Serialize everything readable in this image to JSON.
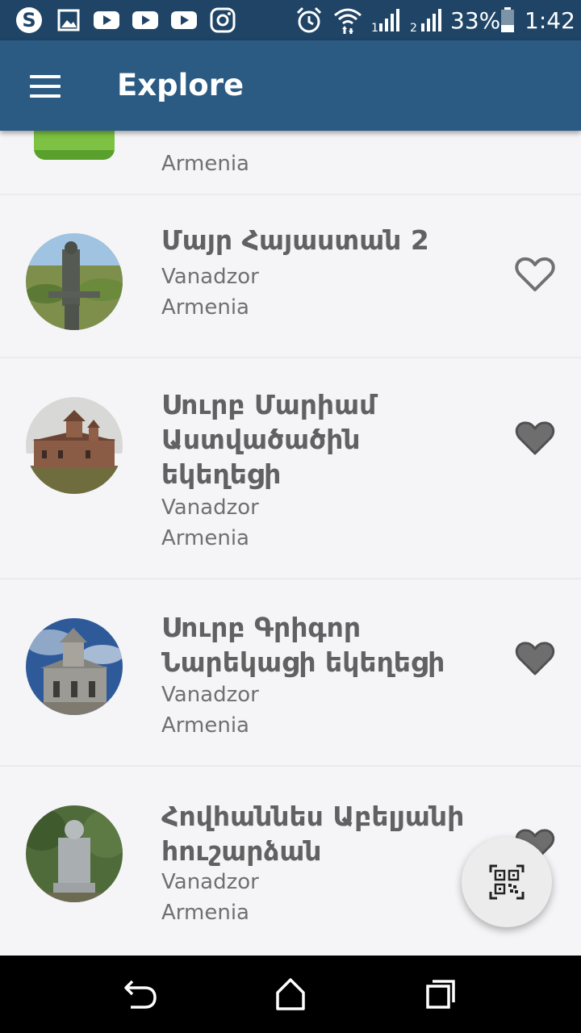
{
  "status_bar": {
    "battery_percent": "33%",
    "time": "1:42",
    "icons": [
      "skype-icon",
      "image-icon",
      "youtube-icon",
      "youtube-icon",
      "youtube-icon",
      "instagram-icon",
      "alarm-icon",
      "wifi-icon",
      "signal-1-icon",
      "signal-2-icon",
      "battery-icon"
    ]
  },
  "app_bar": {
    "title": "Explore",
    "menu_icon": "hamburger-menu-icon"
  },
  "list": {
    "items": [
      {
        "title": "",
        "city": "",
        "country": "Armenia",
        "favorite": false,
        "thumb": "green-placeholder"
      },
      {
        "title": "Մայր Հայաստան 2",
        "city": "Vanadzor",
        "country": "Armenia",
        "favorite": false,
        "thumb": "statue-photo"
      },
      {
        "title": "Սուրբ Մարիամ Աստվածածին եկեղեցի",
        "city": "Vanadzor",
        "country": "Armenia",
        "favorite": true,
        "thumb": "church-photo"
      },
      {
        "title": "Սուրբ Գրիգոր Նարեկացի եկեղեցի",
        "city": "Vanadzor",
        "country": "Armenia",
        "favorite": true,
        "thumb": "church-photo"
      },
      {
        "title": "Հովհաննես Աբելյանի հուշարձան",
        "city": "Vanadzor",
        "country": "Armenia",
        "favorite": true,
        "thumb": "monument-photo"
      }
    ]
  },
  "fab": {
    "icon": "qr-code-icon"
  },
  "nav_bar": {
    "icons": [
      "back-icon",
      "home-icon",
      "recents-icon"
    ]
  },
  "colors": {
    "status_bar": "#1f4466",
    "app_bar": "#2b5a82",
    "background": "#f5f5f7",
    "title_text": "#616161",
    "heart": "#6e6e6e"
  }
}
